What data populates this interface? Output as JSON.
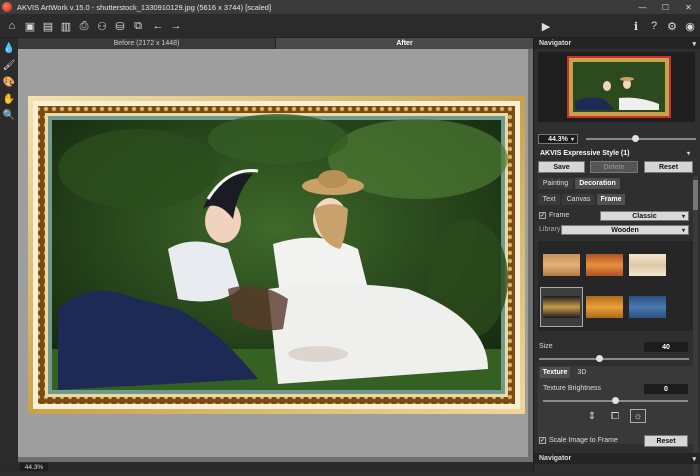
{
  "window": {
    "title": "AKVIS ArtWork v.15.0 - shutterstock_1330910129.jpg (5616 x 3744) [scaled]",
    "controls": [
      "—",
      "☐",
      "✕"
    ]
  },
  "toolbar": {
    "icons": [
      "home-icon",
      "open-icon",
      "save-icon",
      "export-icon",
      "print-icon",
      "share-icon",
      "batch-icon",
      "plugin-icon",
      "undo-icon",
      "redo-icon",
      "run-icon",
      "info-icon",
      "help-icon",
      "settings-icon",
      "feed-icon"
    ],
    "glyphs": {
      "home": "⌂",
      "open": "▣",
      "save": "▤",
      "export": "▥",
      "print": "⎙",
      "share": "⚇",
      "batch": "⛁",
      "plugin": "⧉",
      "undo": "←",
      "redo": "→",
      "run": "▶",
      "info": "ℹ",
      "help": "?",
      "settings": "⚙",
      "feed": "◉"
    }
  },
  "left_tools": {
    "glyphs": [
      "💧",
      "🖌",
      "🎨",
      "✋",
      "🔍"
    ],
    "names": [
      "drop-tool-icon",
      "brush-tool-icon",
      "palette-tool-icon",
      "hand-tool-icon",
      "zoom-tool-icon"
    ]
  },
  "view_tabs": {
    "before": "Before (2172 x 1448)",
    "after": "After"
  },
  "status": {
    "zoom": "44.3%"
  },
  "navigator": {
    "title": "Navigator",
    "zoom": "44.3%",
    "zoom_level": 0.45
  },
  "preset": {
    "name": "AKVIS Expressive Style (1)",
    "save": "Save",
    "delete": "Delete",
    "reset": "Reset"
  },
  "tabs": {
    "main": [
      "Painting",
      "Decoration"
    ],
    "sub": [
      "Text",
      "Canvas",
      "Frame"
    ]
  },
  "frame": {
    "checkbox_label": "Frame",
    "checked": true,
    "type": "Classic",
    "library_label": "Library",
    "library": "Wooden",
    "size_label": "Size",
    "size": "40",
    "size_level": 0.4,
    "texture_tabs": [
      "Texture",
      "3D"
    ],
    "brightness_label": "Texture Brightness",
    "brightness": "0",
    "brightness_level": 0.5,
    "scale_label": "Scale Image to Frame",
    "scale_checked": true,
    "reset": "Reset",
    "align_icons": [
      "⇕",
      "⧠",
      "☼"
    ]
  },
  "colors": {
    "accent_red": "#c9302c",
    "panel_bg": "#2f2f2f",
    "canvas_bg": "#9e9e9e",
    "frame_gold": "#c8a24a"
  },
  "bottom_panel": {
    "title": "Navigator"
  }
}
